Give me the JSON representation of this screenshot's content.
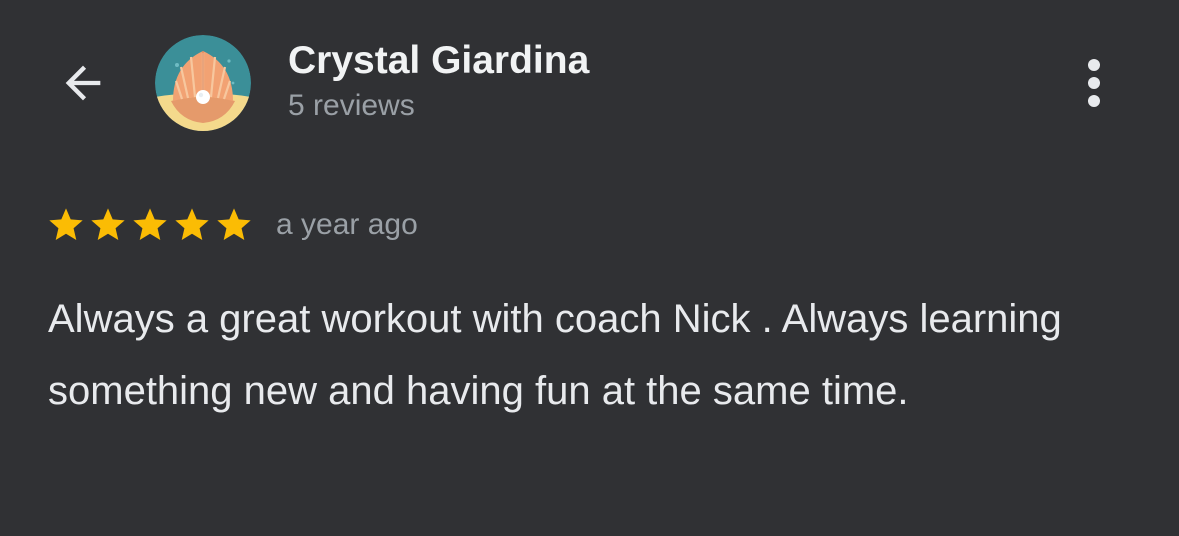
{
  "header": {
    "reviewer_name": "Crystal Giardina",
    "review_count": "5 reviews",
    "back_icon": "arrow-left-icon",
    "more_icon": "more-vertical-icon",
    "avatar_icon": "seashell-pearl-avatar"
  },
  "review": {
    "rating": 5,
    "rating_max": 5,
    "date": "a year ago",
    "text": "Always a great workout with coach Nick . Always learning something new and having fun at the same time."
  },
  "colors": {
    "background": "#303134",
    "star": "#fbbc04",
    "primary_text": "#e8eaed",
    "secondary_text": "#9aa0a6"
  }
}
